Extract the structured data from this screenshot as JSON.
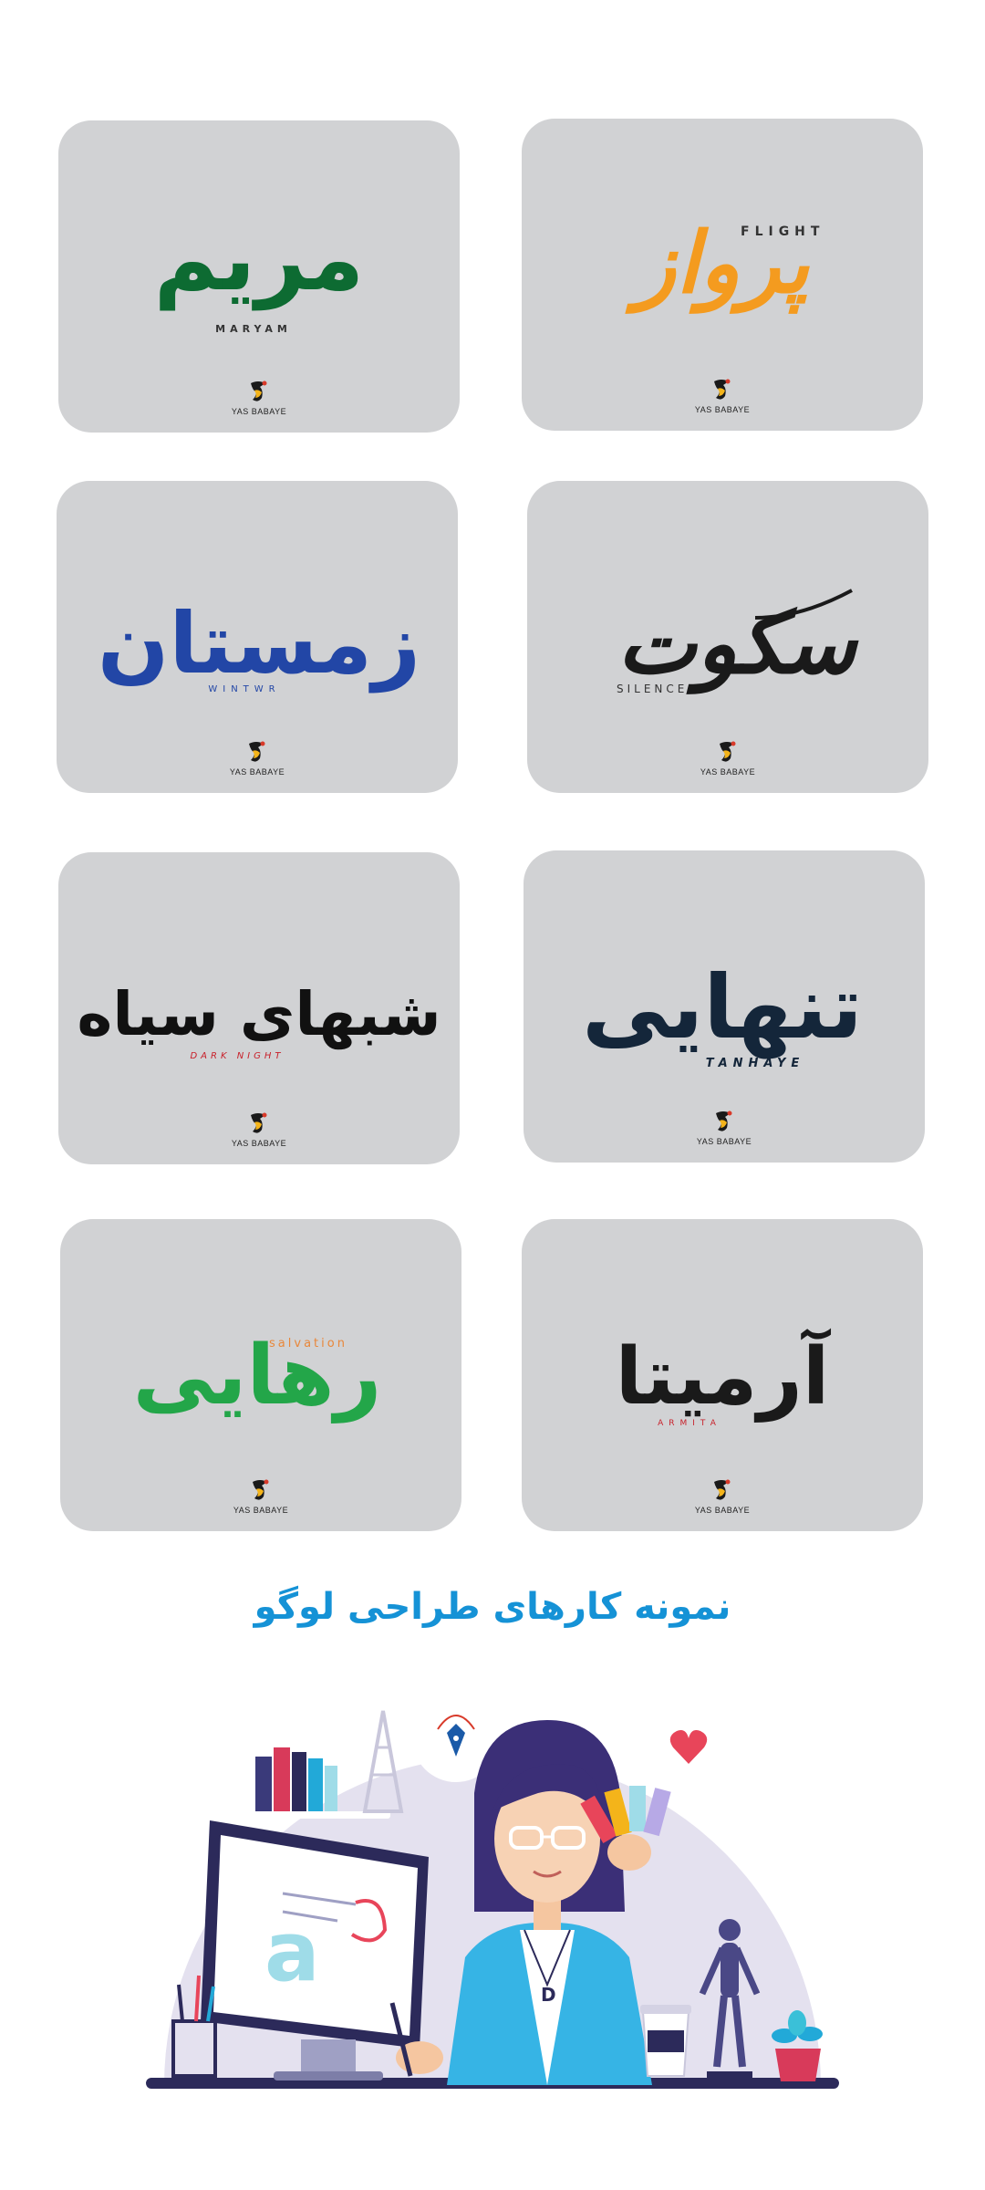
{
  "cards": [
    {
      "id": "parvaz",
      "title": "پرواز",
      "subtitle": "FLIGHT",
      "color": "#f49b1f",
      "subtitle_color": "#333333",
      "signature": "YAS BABAYE"
    },
    {
      "id": "maryam",
      "title": "مریم",
      "subtitle": "MARYAM",
      "color": "#0d6b32",
      "subtitle_color": "#333333",
      "signature": "YAS BABAYE"
    },
    {
      "id": "sokout",
      "title": "سکوت",
      "subtitle": "SILENCE",
      "color": "#1a1a1a",
      "subtitle_color": "#333333",
      "signature": "YAS BABAYE"
    },
    {
      "id": "zemestan",
      "title": "زمستان",
      "subtitle": "WINTWR",
      "color": "#2246a6",
      "subtitle_color": "#2246a6",
      "signature": "YAS BABAYE"
    },
    {
      "id": "tanhaye",
      "title": "تنهایی",
      "subtitle": "TANHAYE",
      "color": "#14263a",
      "subtitle_color": "#14263a",
      "signature": "YAS BABAYE"
    },
    {
      "id": "shabhaye-siah",
      "title": "شبهای سیاه",
      "subtitle": "DARK NIGHT",
      "color": "#111111",
      "subtitle_color": "#c8202a",
      "signature": "YAS BABAYE"
    },
    {
      "id": "armita",
      "title": "آرمیتا",
      "subtitle": "ARMITA",
      "color": "#1a1a1a",
      "subtitle_color": "#c8202a",
      "signature": "YAS BABAYE"
    },
    {
      "id": "rahaee",
      "title": "رهایی",
      "subtitle": "salvation",
      "color": "#23a649",
      "subtitle_color": "#e8873a",
      "signature": "YAS BABAYE"
    }
  ],
  "heading": "نمونه کارهای طراحی لوگو",
  "colors": {
    "card_background": "#d1d2d4",
    "heading": "#1592d6",
    "illustration_circle": "#e4e1ef"
  },
  "illustration": {
    "icons": [
      "pen-tool-icon",
      "heart-icon",
      "books-icon",
      "eiffel-tower-icon",
      "monitor-icon",
      "color-swatches-icon",
      "mannequin-icon",
      "coffee-cup-icon",
      "plant-icon",
      "pencil-cup-icon"
    ],
    "monitor_letter": "a",
    "pendant_letter": "D"
  }
}
